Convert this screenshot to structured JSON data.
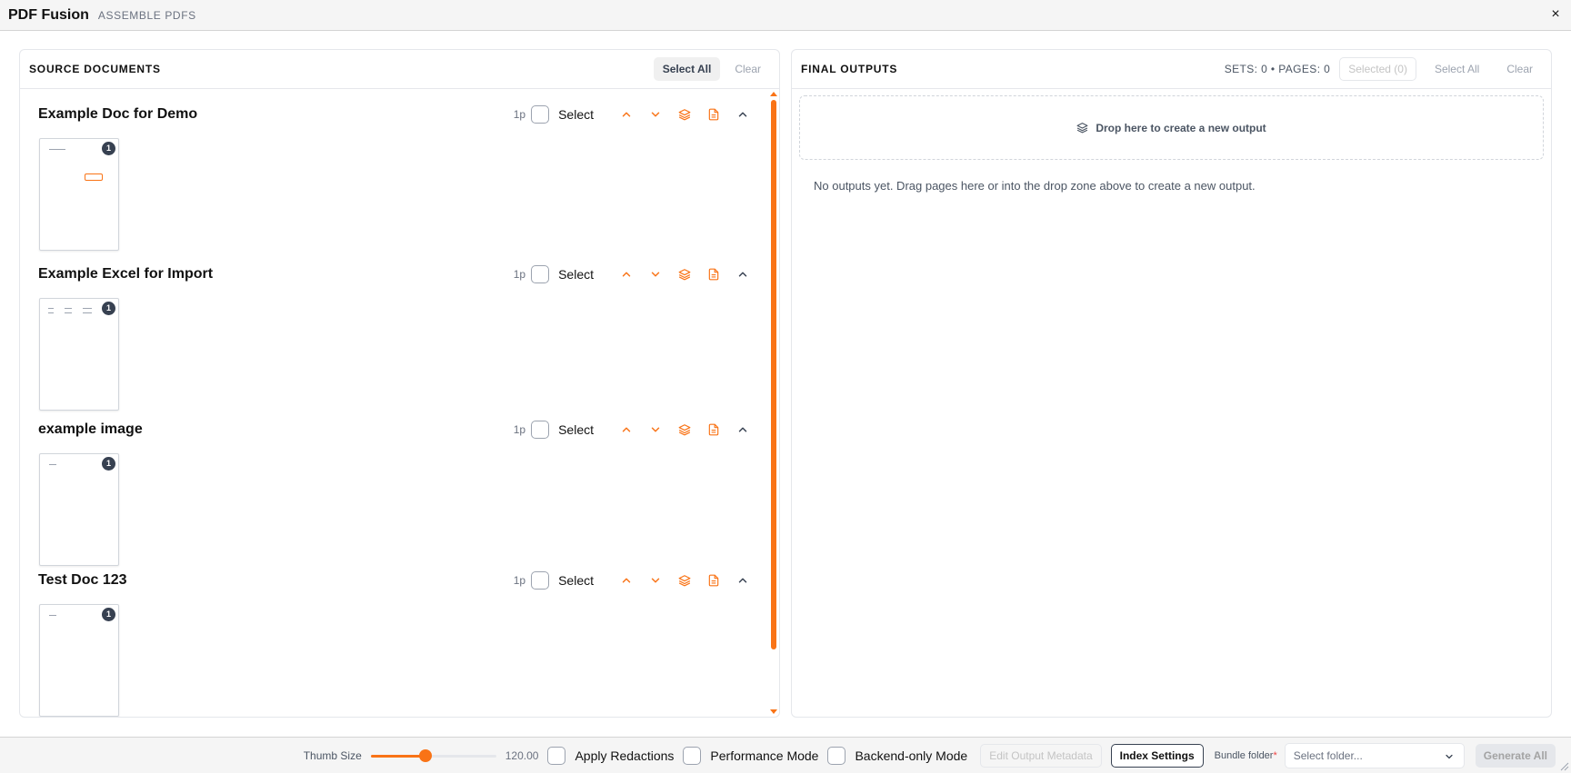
{
  "app": {
    "title": "PDF Fusion",
    "subtitle": "ASSEMBLE PDFS",
    "close": "×"
  },
  "colors": {
    "accent": "#f97316"
  },
  "source": {
    "title": "SOURCE DOCUMENTS",
    "select_all": "Select All",
    "clear": "Clear",
    "documents": [
      {
        "title": "Example Doc for Demo",
        "pages": "1p",
        "select_label": "Select",
        "thumb_badge": "1"
      },
      {
        "title": "Example Excel for Import",
        "pages": "1p",
        "select_label": "Select",
        "thumb_badge": "1"
      },
      {
        "title": "example image",
        "pages": "1p",
        "select_label": "Select",
        "thumb_badge": "1"
      },
      {
        "title": "Test Doc 123",
        "pages": "1p",
        "select_label": "Select",
        "thumb_badge": "1"
      }
    ],
    "doc_tool_icons": [
      "chevron-up-icon",
      "chevron-down-icon",
      "layers-icon",
      "file-icon",
      "collapse-icon"
    ]
  },
  "outputs": {
    "title": "FINAL OUTPUTS",
    "stats": "SETS: 0 • PAGES: 0",
    "selected": "Selected (0)",
    "select_all": "Select All",
    "clear": "Clear",
    "dropzone": "Drop here to create a new output",
    "empty": "No outputs yet. Drag pages here or into the drop zone above to create a new output."
  },
  "footer": {
    "thumb_size_label": "Thumb Size",
    "thumb_size_value": "120.00",
    "thumb_size_fraction": 0.44,
    "apply_redactions": "Apply Redactions",
    "performance_mode": "Performance Mode",
    "backend_only": "Backend-only Mode",
    "edit_metadata": "Edit Output Metadata",
    "index_settings": "Index Settings",
    "bundle_label": "Bundle folder",
    "required_mark": "*",
    "bundle_placeholder": "Select folder...",
    "generate_all": "Generate All"
  }
}
